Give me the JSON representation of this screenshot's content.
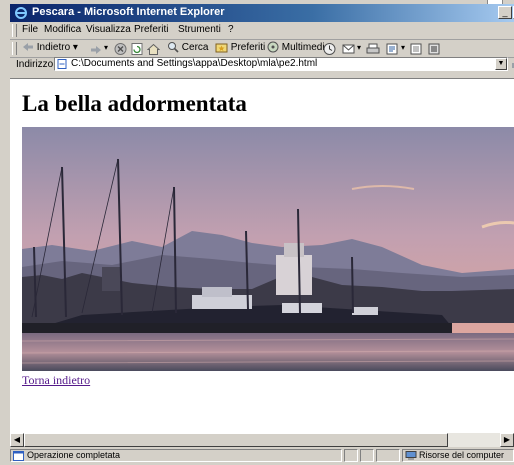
{
  "window": {
    "title": "Pescara - Microsoft Internet Explorer"
  },
  "menu": [
    "File",
    "Modifica",
    "Visualizza",
    "Preferiti",
    "Strumenti",
    "?"
  ],
  "toolbar": {
    "back": "Indietro",
    "search": "Cerca",
    "favorites": "Preferiti",
    "media": "Multimedia"
  },
  "address": {
    "label": "Indirizzo",
    "url": "C:\\Documents and Settings\\appa\\Desktop\\mla\\pe2.html"
  },
  "page": {
    "title": "La bella addormentata",
    "back_link": "Torna indietro"
  },
  "status": {
    "main": "Operazione completata",
    "zone": "Risorse del computer"
  },
  "colors": {
    "titlebar": "#0a246a",
    "link_visited": "#551a8b",
    "sky_top": "#8c8aa8",
    "sky_bottom": "#e8a898",
    "sea": "#4a4a5c"
  },
  "icons": [
    "ie-logo-icon",
    "back-arrow-icon",
    "forward-arrow-icon",
    "stop-icon",
    "refresh-icon",
    "home-icon",
    "search-icon",
    "favorites-icon",
    "media-icon",
    "history-icon",
    "mail-icon",
    "print-icon",
    "edit-icon",
    "discuss-icon",
    "messenger-icon",
    "page-icon",
    "go-icon",
    "my-computer-icon"
  ]
}
